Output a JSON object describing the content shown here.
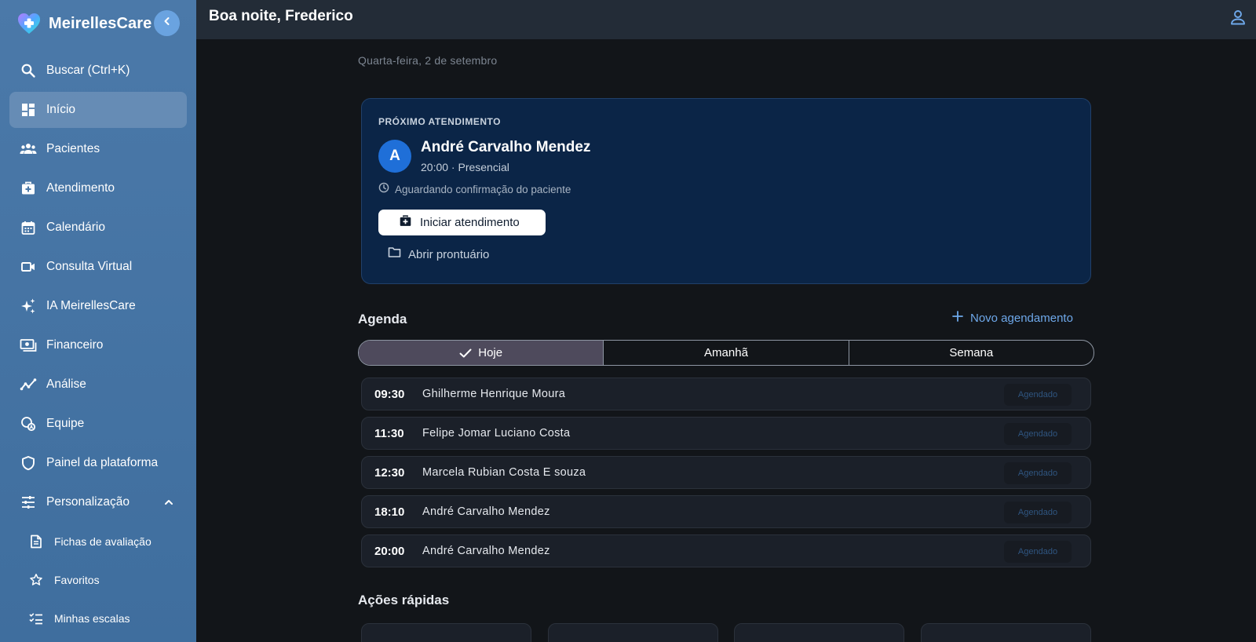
{
  "brand": {
    "name": "MeirellesCare"
  },
  "sidebar": {
    "items": [
      {
        "label": "Buscar (Ctrl+K)",
        "icon": "search-icon"
      },
      {
        "label": "Início",
        "icon": "dashboard-icon",
        "active": true
      },
      {
        "label": "Pacientes",
        "icon": "people-icon"
      },
      {
        "label": "Atendimento",
        "icon": "medical-bag-icon"
      },
      {
        "label": "Calendário",
        "icon": "calendar-icon"
      },
      {
        "label": "Consulta Virtual",
        "icon": "video-camera-icon"
      },
      {
        "label": "IA MeirellesCare",
        "icon": "sparkles-icon"
      },
      {
        "label": "Financeiro",
        "icon": "money-icon"
      },
      {
        "label": "Análise",
        "icon": "analytics-icon"
      },
      {
        "label": "Equipe",
        "icon": "team-icon"
      },
      {
        "label": "Painel da plataforma",
        "icon": "shield-icon"
      },
      {
        "label": "Personalização",
        "icon": "tune-icon",
        "expanded": true
      }
    ],
    "subitems": [
      {
        "label": "Fichas de avaliação",
        "icon": "document-icon"
      },
      {
        "label": "Favoritos",
        "icon": "star-icon"
      },
      {
        "label": "Minhas escalas",
        "icon": "checklist-icon"
      }
    ]
  },
  "header": {
    "greeting": "Boa noite, Frederico"
  },
  "main": {
    "date": "Quarta-feira, 2 de setembro",
    "next": {
      "label": "PRÓXIMO ATENDIMENTO",
      "avatar_initial": "A",
      "patient": "André Carvalho Mendez",
      "meta": "20:00 · Presencial",
      "status": "Aguardando confirmação do paciente",
      "start_label": "Iniciar atendimento",
      "open_label": "Abrir prontuário"
    },
    "agenda": {
      "title": "Agenda",
      "new_label": "Novo agendamento",
      "tabs": [
        {
          "label": "Hoje",
          "active": true
        },
        {
          "label": "Amanhã"
        },
        {
          "label": "Semana"
        }
      ],
      "rows": [
        {
          "time": "09:30",
          "name": "Ghilherme Henrique Moura",
          "status": "Agendado"
        },
        {
          "time": "11:30",
          "name": "Felipe Jomar Luciano Costa",
          "status": "Agendado"
        },
        {
          "time": "12:30",
          "name": "Marcela Rubian Costa E souza",
          "status": "Agendado"
        },
        {
          "time": "18:10",
          "name": "André Carvalho Mendez",
          "status": "Agendado"
        },
        {
          "time": "20:00",
          "name": "André Carvalho Mendez",
          "status": "Agendado"
        }
      ]
    },
    "quick": {
      "title": "Ações rápidas"
    }
  },
  "colors": {
    "sidebar": "#4b79a9",
    "accent": "#6ea8ea",
    "card": "#0b2547",
    "background": "#121519"
  }
}
